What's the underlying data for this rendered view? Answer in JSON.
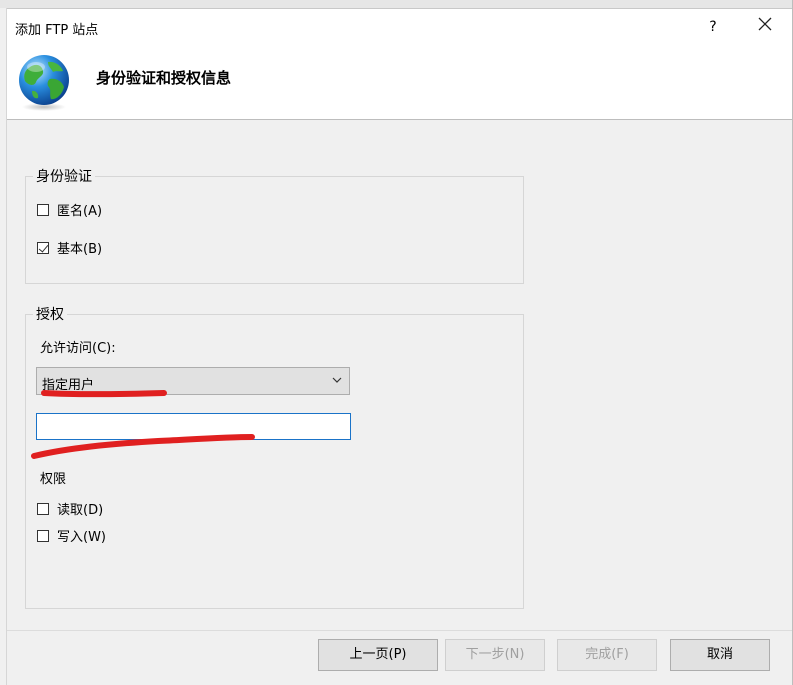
{
  "window": {
    "title": "添加 FTP 站点",
    "help_label": "?",
    "close_label": "✕"
  },
  "header": {
    "heading": "身份验证和授权信息",
    "icon": "globe-icon"
  },
  "authentication": {
    "group_title": "身份验证",
    "anonymous": {
      "label": "匿名(A)",
      "checked": false
    },
    "basic": {
      "label": "基本(B)",
      "checked": true
    }
  },
  "authorization": {
    "group_title": "授权",
    "allow_access_label": "允许访问(C):",
    "allow_access_value": "指定用户",
    "user_input_value": "",
    "permissions_label": "权限",
    "read": {
      "label": "读取(D)",
      "checked": false
    },
    "write": {
      "label": "写入(W)",
      "checked": false
    }
  },
  "buttons": {
    "previous": {
      "label": "上一页(P)",
      "enabled": true
    },
    "next": {
      "label": "下一步(N)",
      "enabled": false
    },
    "finish": {
      "label": "完成(F)",
      "enabled": false
    },
    "cancel": {
      "label": "取消",
      "enabled": true
    }
  },
  "colors": {
    "annotation_red": "#e02020",
    "input_focus_border": "#1a73c8"
  }
}
